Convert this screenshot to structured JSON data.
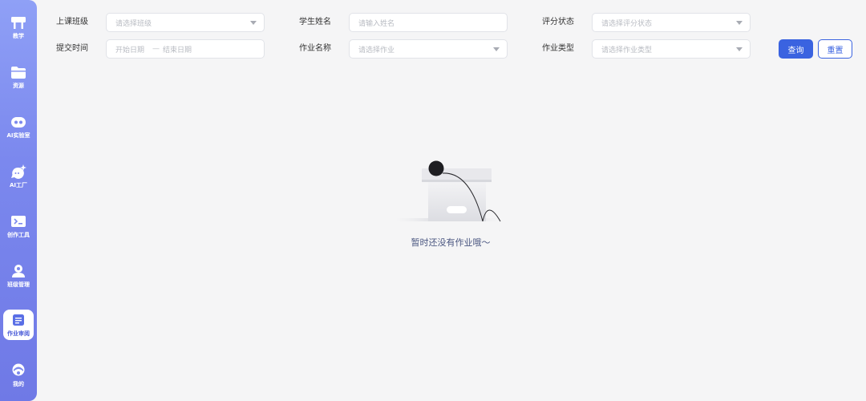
{
  "sidebar": {
    "items": [
      {
        "label": "教学",
        "icon": "podium-icon"
      },
      {
        "label": "资源",
        "icon": "folder-icon"
      },
      {
        "label": "AI实验室",
        "icon": "robot-icon"
      },
      {
        "label": "AI工厂",
        "icon": "chat-spark-icon"
      },
      {
        "label": "创作工具",
        "icon": "terminal-icon"
      },
      {
        "label": "班级管理",
        "icon": "class-gear-icon"
      },
      {
        "label": "作业审阅",
        "icon": "homework-icon"
      },
      {
        "label": "我的",
        "icon": "user-icon"
      }
    ],
    "active_index": 6
  },
  "filters": {
    "class": {
      "label": "上课班级",
      "placeholder": "请选择班级"
    },
    "student": {
      "label": "学生姓名",
      "placeholder": "请输入姓名"
    },
    "status": {
      "label": "评分状态",
      "placeholder": "请选择评分状态"
    },
    "submit_time": {
      "label": "提交时间",
      "start_placeholder": "开始日期",
      "separator": "—",
      "end_placeholder": "结束日期"
    },
    "homework": {
      "label": "作业名称",
      "placeholder": "请选择作业"
    },
    "type": {
      "label": "作业类型",
      "placeholder": "请选择作业类型"
    }
  },
  "buttons": {
    "query": "查询",
    "reset": "重置"
  },
  "empty": {
    "message": "暂时还没有作业哦～"
  },
  "colors": {
    "accent": "#3a63e0",
    "sidebar": "#7b88ee",
    "background": "#f5f5f6"
  }
}
